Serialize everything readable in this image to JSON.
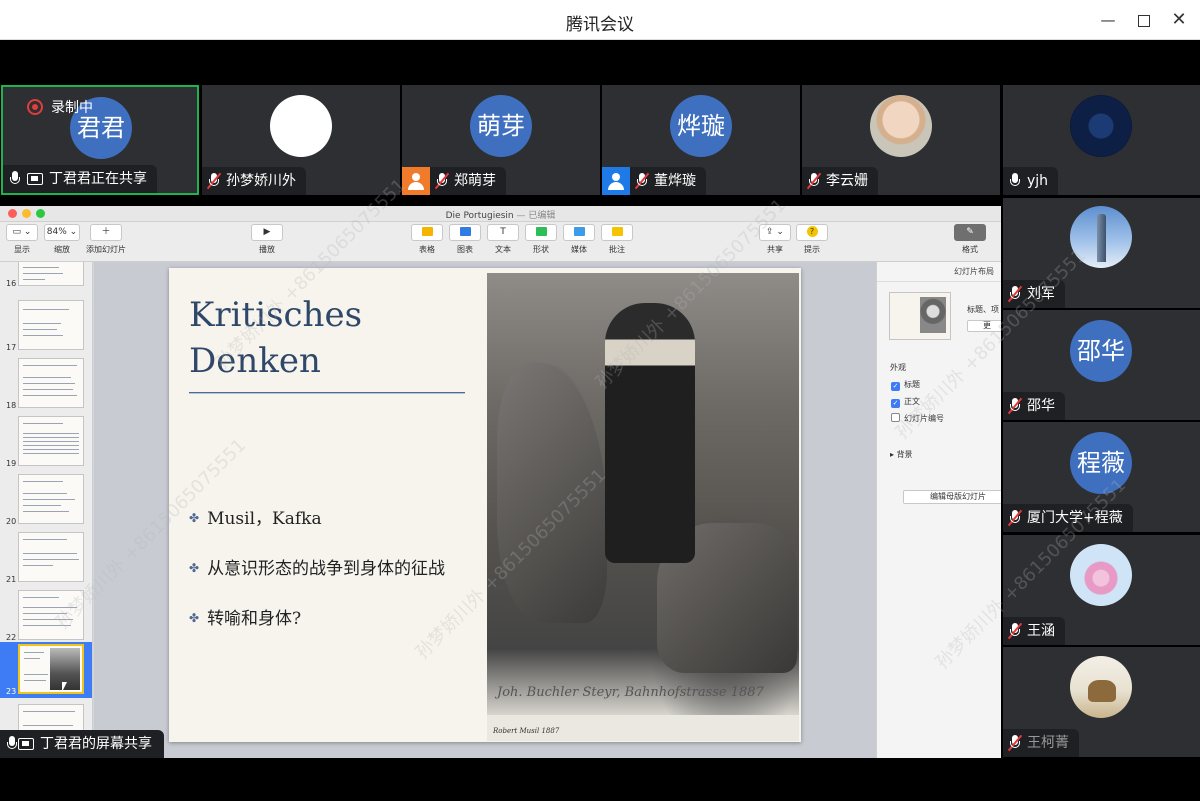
{
  "window": {
    "title": "腾讯会议"
  },
  "recording": {
    "label": "录制中"
  },
  "participants_top": [
    {
      "name": "丁君君正在共享",
      "avatar_text": "君君",
      "mic": "on",
      "sharing": true,
      "badge": ""
    },
    {
      "name": "孙梦娇川外",
      "avatar_text": "",
      "mic": "muted",
      "sharing": false,
      "badge": ""
    },
    {
      "name": "郑萌芽",
      "avatar_text": "萌芽",
      "mic": "muted",
      "sharing": false,
      "badge": "orange"
    },
    {
      "name": "董烨璇",
      "avatar_text": "烨璇",
      "mic": "muted",
      "sharing": false,
      "badge": "blue"
    },
    {
      "name": "李云姗",
      "avatar_text": "",
      "mic": "muted",
      "sharing": false,
      "badge": ""
    }
  ],
  "participants_side": [
    {
      "name": "yjh",
      "avatar_text": "",
      "mic": "on"
    },
    {
      "name": "刘军",
      "avatar_text": "",
      "mic": "muted"
    },
    {
      "name": "邵华",
      "avatar_text": "邵华",
      "mic": "muted"
    },
    {
      "name": "厦门大学+程薇",
      "avatar_text": "程薇",
      "mic": "muted"
    },
    {
      "name": "王涵",
      "avatar_text": "",
      "mic": "muted"
    },
    {
      "name": "王柯菁",
      "avatar_text": "",
      "mic": "muted"
    }
  ],
  "share_label": "丁君君的屏幕共享",
  "watermark": "孙梦娇川外 +8615065075551",
  "keynote": {
    "doc_name": "Die Portugiesin",
    "doc_status": "— 已编辑",
    "toolbar": {
      "view": "显示",
      "zoom_value": "84%",
      "zoom": "缩放",
      "add_slide": "添加幻灯片",
      "play": "播放",
      "table": "表格",
      "chart": "图表",
      "text": "文本",
      "shape": "形状",
      "media": "媒体",
      "comment": "批注",
      "share": "共享",
      "tips": "提示",
      "format": "格式"
    },
    "thumb_numbers": [
      "16",
      "17",
      "18",
      "19",
      "20",
      "21",
      "22",
      "23"
    ],
    "selected_thumb": "23",
    "inspector": {
      "header": "幻灯片布局",
      "layout_label": "标题、项",
      "change_button": "更",
      "appearance": "外观",
      "chk_title": "标题",
      "chk_body": "正文",
      "chk_number": "幻灯片编号",
      "background": "背景",
      "edit_master": "编辑母版幻灯片"
    }
  },
  "slide": {
    "title_line1": "Kritisches",
    "title_line2": "Denken",
    "bullets": [
      "Musil，Kafka",
      "从意识形态的战争到身体的征战",
      "转喻和身体?"
    ],
    "photo_signature": "Joh. Buchler Steyr, Bahnhofstrasse 1887",
    "photo_caption": "Robert Musil 1887"
  }
}
